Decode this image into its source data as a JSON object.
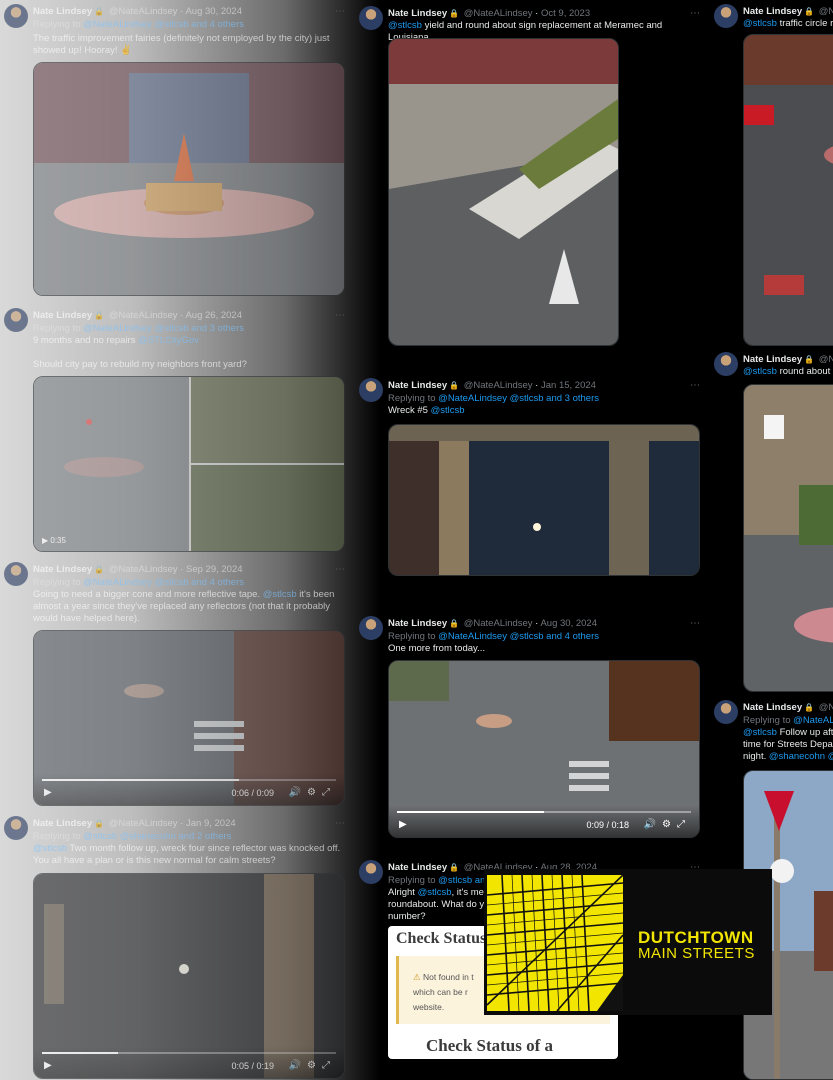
{
  "author": {
    "name": "Nate Lindsey",
    "handle": "@NateALindsey"
  },
  "left": [
    {
      "date": "Aug 30, 2024",
      "reply": "Replying to",
      "reply_to": "@NateALindsey @stlcsb and 4 others",
      "text": "The traffic improvement fairies (definitely not employed by the city) just showed up!  Hooray! ✌"
    },
    {
      "date": "Aug 26, 2024",
      "reply": "Replying to",
      "reply_to": "@NateALindsey @stlcsb and 3 others",
      "text1": "9 months and no repairs",
      "mention1": "@STLCityGov",
      "text2": "Should city pay to rebuild my neighbors front yard?",
      "video_time": "0:35"
    },
    {
      "date": "Sep 29, 2024",
      "reply": "Replying to",
      "reply_to": "@NateALindsey @stlcsb and 4 others",
      "text_a": "Going to need a bigger cone and more reflective tape. ",
      "mention": "@stlcsb",
      "text_b": " it's been almost a year since they've replaced any reflectors (not that it probably would have helped here).",
      "video_time": "0:06 / 0:09",
      "progress": 0.67
    },
    {
      "date": "Jan 9, 2024",
      "reply": "Replying to",
      "reply_to": "@stlcsb @shanecohn and 2 others",
      "mention": "@stlcsb",
      "text": " Two month follow up, wreck four since reflector was knocked off. You all have a plan or is this new normal for calm streets?",
      "video_time": "0:05 / 0:19",
      "progress": 0.26
    }
  ],
  "mid": [
    {
      "date": "Oct 9, 2023",
      "mention": "@stlcsb",
      "text": " yield and round about sign replacement at Meramec and Louisiana"
    },
    {
      "date": "Jan 15, 2024",
      "reply": "Replying to",
      "reply_to": "@NateALindsey @stlcsb and 3 others",
      "text": "Wreck #5 ",
      "mention": "@stlcsb"
    },
    {
      "date": "Aug 30, 2024",
      "reply": "Replying to",
      "reply_to": "@NateALindsey @stlcsb and 4 others",
      "text": "One more from today...",
      "video_time": "0:09 / 0:18",
      "progress": 0.5
    },
    {
      "date": "Aug 28, 2024",
      "reply": "Replying to",
      "reply_to": "@stlcsb and",
      "text_a": "Alright ",
      "mention": "@stlcsb",
      "text_b": ", it's me",
      "text_c": "roundabout.  What do y",
      "text_d": "number?",
      "doc_title": "Check Status",
      "doc_warn1": "Not found in t",
      "doc_warn2": "which can be r",
      "doc_warn3": "website.",
      "doc_title2": "Check Status of a"
    }
  ],
  "right": [
    {
      "name": "Nate Lindsey",
      "handle": "@Na",
      "mention": "@stlcsb",
      "text": " traffic circle r"
    },
    {
      "name": "Nate Lindsey",
      "handle": "@Nat",
      "mention": "@stlcsb",
      "text": " round about s"
    },
    {
      "name": "Nate Lindsey",
      "handle": "@Na",
      "reply": "Replying to",
      "reply_to": "@NateALin",
      "mention": "@stlcsb",
      "text1": " Follow up afte",
      "text2": "time for Streets Depar",
      "text3": "night. ",
      "mention2": "@shanecohn @"
    }
  ],
  "logo": {
    "line1": "DUTCHTOWN",
    "line2": "MAIN STREETS",
    "yellow": "#f2e500"
  },
  "icons": {
    "more": "more-icon",
    "gif": "gif-icon",
    "lock": "lock-icon"
  }
}
